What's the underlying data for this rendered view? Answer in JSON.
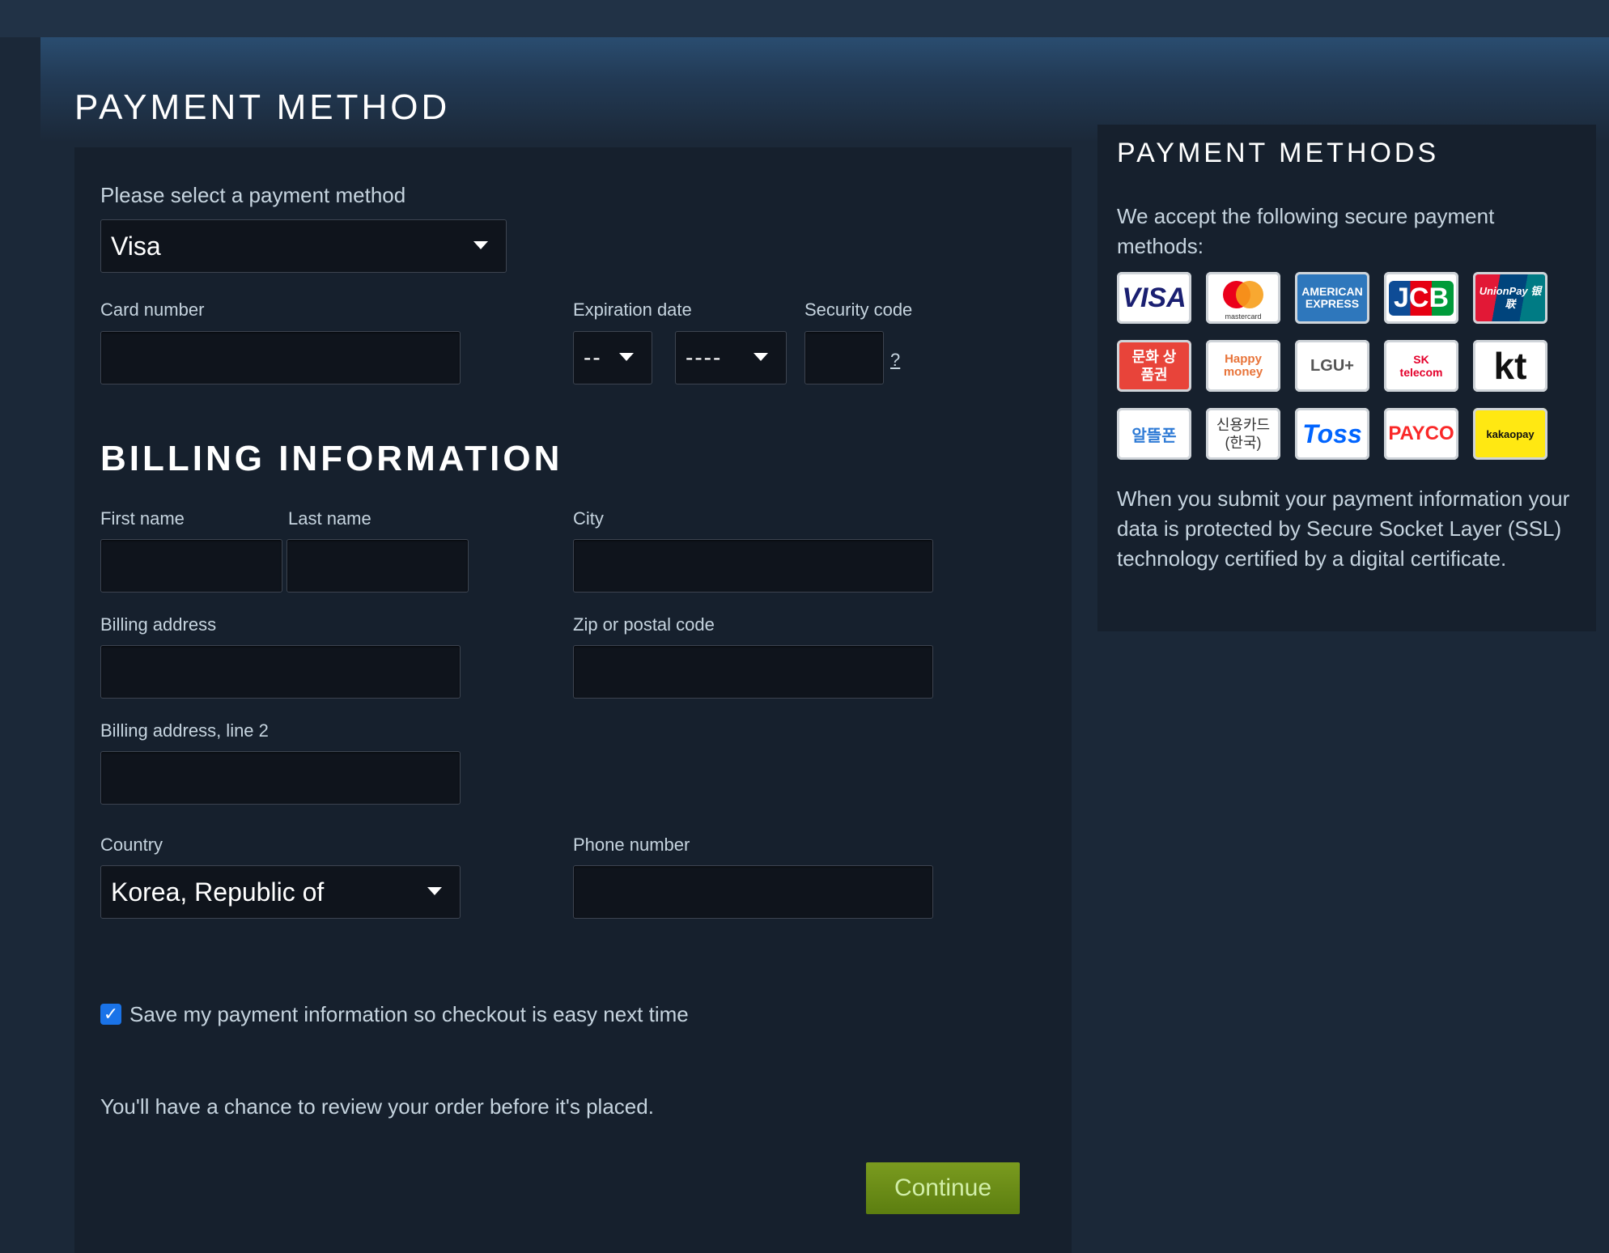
{
  "page": {
    "title": "PAYMENT METHOD"
  },
  "payment": {
    "select_label": "Please select a payment method",
    "selected_method": "Visa",
    "card_number_label": "Card number",
    "card_number_value": "",
    "expiration_label": "Expiration date",
    "exp_month_value": "--",
    "exp_year_value": "----",
    "security_label": "Security code",
    "security_value": "",
    "security_help": "?"
  },
  "billing": {
    "title": "BILLING INFORMATION",
    "first_name_label": "First name",
    "last_name_label": "Last name",
    "city_label": "City",
    "address_label": "Billing address",
    "zip_label": "Zip or postal code",
    "address2_label": "Billing address, line 2",
    "country_label": "Country",
    "country_value": "Korea, Republic of",
    "phone_label": "Phone number"
  },
  "save_info": {
    "checked": true,
    "label": "Save my payment information so checkout is easy next time"
  },
  "review_note": "You'll have a chance to review your order before it's placed.",
  "continue_label": "Continue",
  "side": {
    "title": "PAYMENT METHODS",
    "intro": "We accept the following secure payment methods:",
    "ssl_note": "When you submit your payment information your data is protected by Secure Socket Layer (SSL) technology certified by a digital certificate.",
    "logos": [
      {
        "name": "visa",
        "text": "VISA"
      },
      {
        "name": "mastercard",
        "text": "mastercard"
      },
      {
        "name": "american-express",
        "text": "AMERICAN EXPRESS"
      },
      {
        "name": "jcb",
        "text": "JCB"
      },
      {
        "name": "unionpay",
        "text": "UnionPay 银联"
      },
      {
        "name": "culture-gift",
        "text": "문화 상품권"
      },
      {
        "name": "happy-money",
        "text": "Happy money"
      },
      {
        "name": "lgu",
        "text": "LGU+"
      },
      {
        "name": "sk-telecom",
        "text": "SK telecom"
      },
      {
        "name": "kt",
        "text": "kt"
      },
      {
        "name": "altteul-phone",
        "text": "알뜰폰"
      },
      {
        "name": "credit-card-korea",
        "text": "신용카드 (한국)"
      },
      {
        "name": "toss",
        "text": "Toss"
      },
      {
        "name": "payco",
        "text": "PAYCO"
      },
      {
        "name": "kakaopay",
        "text": "kakaopay"
      }
    ]
  },
  "colors": {
    "background": "#1b2838",
    "panel": "#16202d",
    "accent_button": "#6a8c19",
    "checkbox": "#1a73e8"
  }
}
